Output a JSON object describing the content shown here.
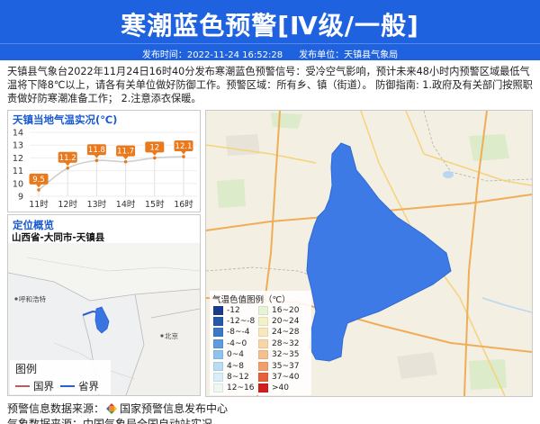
{
  "header": {
    "title": "寒潮蓝色预警[Ⅳ级/一般]",
    "publish_time": "发布时间：2022-11-24 16:52:28",
    "publisher": "发布单位：天镇县气象局",
    "color": "#1f62e0"
  },
  "description": "天镇县气象台2022年11月24日16时40分发布寒潮蓝色预警信号：受冷空气影响，预计未来48小时内预警区域最低气温将下降8℃以上，请各有关单位做好防御工作。预警区域：所有乡、镇（街道）。 防御指南: 1.政府及有关部门按照职责做好防寒潮准备工作； 2.注意添衣保暖。",
  "chart_data": {
    "type": "line",
    "title": "天镇当地气温实况(℃)",
    "categories": [
      "11时",
      "12时",
      "13时",
      "14时",
      "15时",
      "16时"
    ],
    "series": [
      {
        "values": [
          9.5,
          11.2,
          11.8,
          11.7,
          12,
          12.1
        ]
      }
    ],
    "yticks": [
      9,
      10,
      11,
      12,
      13,
      14
    ],
    "ylim": [
      9,
      14
    ],
    "grid": true,
    "label_color": "#e8791d"
  },
  "locator": {
    "title": "定位概览",
    "region": "山西省-大同市-天镇县",
    "cities": [
      {
        "name": "呼和浩特"
      },
      {
        "name": "北京"
      }
    ],
    "highlight_color": "#3a74e0",
    "legend": {
      "title": "图例",
      "items": [
        {
          "label": "国界",
          "color": "#b0605e"
        },
        {
          "label": "省界",
          "color": "#2a5fd0"
        }
      ]
    }
  },
  "map": {
    "warning_area_color": "#3d7ae6",
    "legend_title": "气温色值图例（℃）",
    "legend": [
      {
        "label": "-12",
        "color": "#1b3c8c"
      },
      {
        "label": "-12~-8",
        "color": "#2558a8"
      },
      {
        "label": "-8~-4",
        "color": "#3b78c8"
      },
      {
        "label": "-4~0",
        "color": "#5d9be0"
      },
      {
        "label": "0~4",
        "color": "#8dc4ef"
      },
      {
        "label": "4~8",
        "color": "#b7dcf4"
      },
      {
        "label": "8~12",
        "color": "#d8eef8"
      },
      {
        "label": "12~16",
        "color": "#eef8f2"
      },
      {
        "label": "16~20",
        "color": "#e6f4d6"
      },
      {
        "label": "20~24",
        "color": "#f3f1c8"
      },
      {
        "label": "24~28",
        "color": "#f9e8bd"
      },
      {
        "label": "28~32",
        "color": "#f9d6a6"
      },
      {
        "label": "32~35",
        "color": "#f7bf8e"
      },
      {
        "label": "35~37",
        "color": "#f0a06d"
      },
      {
        "label": "37~40",
        "color": "#e5603d"
      },
      {
        "label": ">40",
        "color": "#cf1f1f"
      }
    ]
  },
  "footer": {
    "warning_source_label": "预警信息数据来源：",
    "warning_source": "国家预警信息发布中心",
    "weather_source": "气象数据来源：中国气象局全国自动站实况"
  }
}
